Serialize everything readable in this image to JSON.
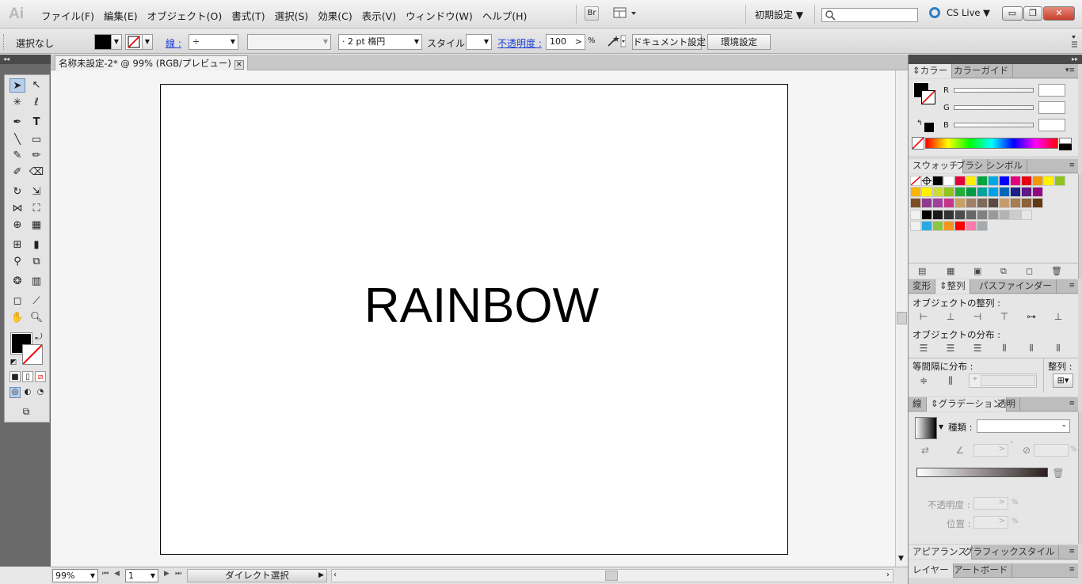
{
  "app": {
    "logo": "Ai"
  },
  "menu": [
    "ファイル(F)",
    "編集(E)",
    "オブジェクト(O)",
    "書式(T)",
    "選択(S)",
    "効果(C)",
    "表示(V)",
    "ウィンドウ(W)",
    "ヘルプ(H)"
  ],
  "menubar": {
    "bridge": "Br",
    "workspace": "初期設定 ▼",
    "cslive": "CS Live ▼",
    "minimize": "▭",
    "maximize": "❐",
    "close": "✕"
  },
  "control": {
    "selection": "選択なし",
    "stroke_label": "線 :",
    "stroke_weight_spinner": "÷",
    "brush_value": "· 2 pt 楕円",
    "style_label": "スタイル :",
    "opacity_label": "不透明度 :",
    "opacity_value": "100",
    "opacity_arrow": ">",
    "opacity_unit": "%",
    "document_setup": "ドキュメント設定",
    "preferences": "環境設定"
  },
  "document": {
    "tab_title": "名称未設定-2* @ 99% (RGB/プレビュー)",
    "tab_close": "✕",
    "artwork_text": "RAINBOW"
  },
  "status": {
    "zoom": "99%",
    "artboard": "1",
    "tool": "ダイレクト選択"
  },
  "panels": {
    "color": {
      "tab": "カラー",
      "tab2": "カラーガイド",
      "r": "R",
      "g": "G",
      "b": "B"
    },
    "swatches": {
      "tab": "スウォッチ",
      "tab2": "ブラシ",
      "tab3": "シンボル"
    },
    "align": {
      "tab": "変形",
      "tab2": "整列",
      "tab3": "パスファインダー",
      "align_objects": "オブジェクトの整列 :",
      "distribute_objects": "オブジェクトの分布 :",
      "distribute_spacing": "等間隔に分布 :",
      "align_to": "整列 :"
    },
    "gradient": {
      "tab": "線",
      "tab2": "グラデーション",
      "tab3": "透明",
      "type_label": "種類 :",
      "opacity_label": "不透明度 :",
      "location_label": "位置 :",
      "angle_unit": "°",
      "aspect_unit": "%",
      "opacity_unit": "%",
      "location_unit": "%"
    },
    "appearance": {
      "tab": "アピアランス",
      "tab2": "グラフィックスタイル"
    },
    "layers": {
      "tab": "レイヤー",
      "tab2": "アートボード"
    }
  },
  "swatch_colors": [
    [
      "#000000",
      "#ffffff",
      "#e4003a",
      "#ffef00",
      "#00a53c",
      "#00a9e0",
      "#0000ff",
      "#e4007f",
      "#e60012",
      "#f39800",
      "#fff100",
      "#8fc31f"
    ],
    [
      "#f8b500",
      "#fff100",
      "#cddc39",
      "#8fc31f",
      "#22ac38",
      "#009944",
      "#00a29a",
      "#00a0e9",
      "#0068b7",
      "#1d2088",
      "#601986",
      "#920783"
    ],
    [
      "#7d4e24",
      "#8f3b8f",
      "#a23e9c",
      "#c7358b",
      "#c8a063",
      "#a0806a",
      "#7f6a5a",
      "#5a4a3f",
      "#c69c6d",
      "#a67c52",
      "#8c6239",
      "#603913"
    ],
    [
      "#000000",
      "#1a1a1a",
      "#333333",
      "#4d4d4d",
      "#666666",
      "#808080",
      "#999999",
      "#b3b3b3",
      "#cccccc",
      "#e6e6e6"
    ],
    [
      "#29abe2",
      "#8cc63f",
      "#f7931e",
      "#ff0000",
      "#ff7bac",
      "#a7a9ac"
    ]
  ]
}
